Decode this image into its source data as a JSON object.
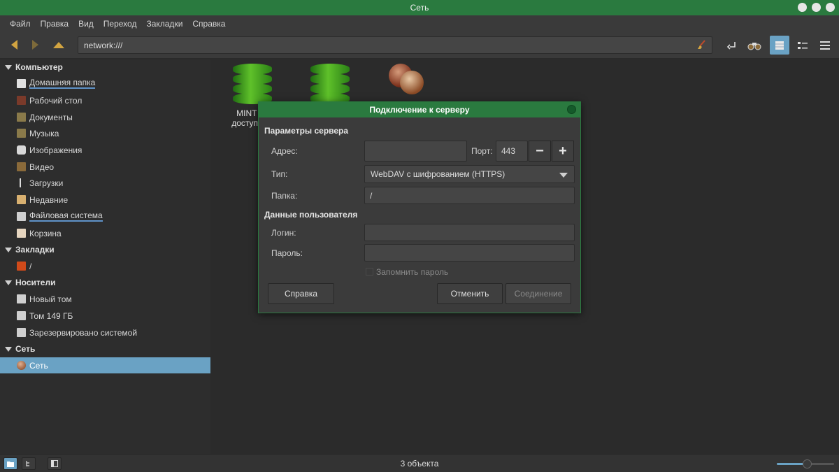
{
  "window": {
    "title": "Сеть"
  },
  "menu": [
    "Файл",
    "Правка",
    "Вид",
    "Переход",
    "Закладки",
    "Справка"
  ],
  "toolbar": {
    "address": "network:///"
  },
  "sidebar": {
    "sections": [
      {
        "label": "Компьютер"
      },
      {
        "label": "Закладки"
      },
      {
        "label": "Носители"
      },
      {
        "label": "Сеть"
      }
    ],
    "computer_items": [
      {
        "label": "Домашняя папка",
        "icon": "home-icon"
      },
      {
        "label": "Рабочий стол",
        "icon": "desktop-icon"
      },
      {
        "label": "Документы",
        "icon": "documents-icon"
      },
      {
        "label": "Музыка",
        "icon": "music-icon"
      },
      {
        "label": "Изображения",
        "icon": "camera-icon"
      },
      {
        "label": "Видео",
        "icon": "video-icon"
      },
      {
        "label": "Загрузки",
        "icon": "download-icon"
      },
      {
        "label": "Недавние",
        "icon": "recent-icon"
      },
      {
        "label": "Файловая система",
        "icon": "drive-icon"
      },
      {
        "label": "Корзина",
        "icon": "trash-icon"
      }
    ],
    "bookmark_items": [
      {
        "label": "/",
        "icon": "folder-icon"
      }
    ],
    "device_items": [
      {
        "label": "Новый том",
        "icon": "drive-icon"
      },
      {
        "label": "Том 149 ГБ",
        "icon": "drive-icon"
      },
      {
        "label": "Зарезервировано системой",
        "icon": "drive-icon"
      }
    ],
    "network_items": [
      {
        "label": "Сеть",
        "icon": "network-icon",
        "selected": true
      }
    ]
  },
  "files": [
    {
      "label_line1": "MINT (O",
      "label_line2": "доступ к ф",
      "icon": "database-icon"
    },
    {
      "label_line1": "",
      "label_line2": "",
      "icon": "database-icon"
    },
    {
      "label_line1": "",
      "label_line2": "",
      "icon": "globe-icon"
    }
  ],
  "dialog": {
    "title": "Подключение к серверу",
    "server_params_heading": "Параметры сервера",
    "address_label": "Адрес:",
    "address_value": "",
    "port_label": "Порт:",
    "port_value": "443",
    "type_label": "Тип:",
    "type_value": "WebDAV с шифрованием (HTTPS)",
    "folder_label": "Папка:",
    "folder_value": "/",
    "user_heading": "Данные пользователя",
    "login_label": "Логин:",
    "login_value": "",
    "password_label": "Пароль:",
    "password_value": "",
    "remember_label": "Запомнить пароль",
    "remember_checked": false,
    "help_button": "Справка",
    "cancel_button": "Отменить",
    "connect_button": "Соединение",
    "minus": "−",
    "plus": "+"
  },
  "status": {
    "text": "3 объекта",
    "zoom_fraction": 0.5
  },
  "colors": {
    "accent": "#2a7a3f",
    "selection": "#6aa2c4",
    "folder": "#d2a441"
  }
}
